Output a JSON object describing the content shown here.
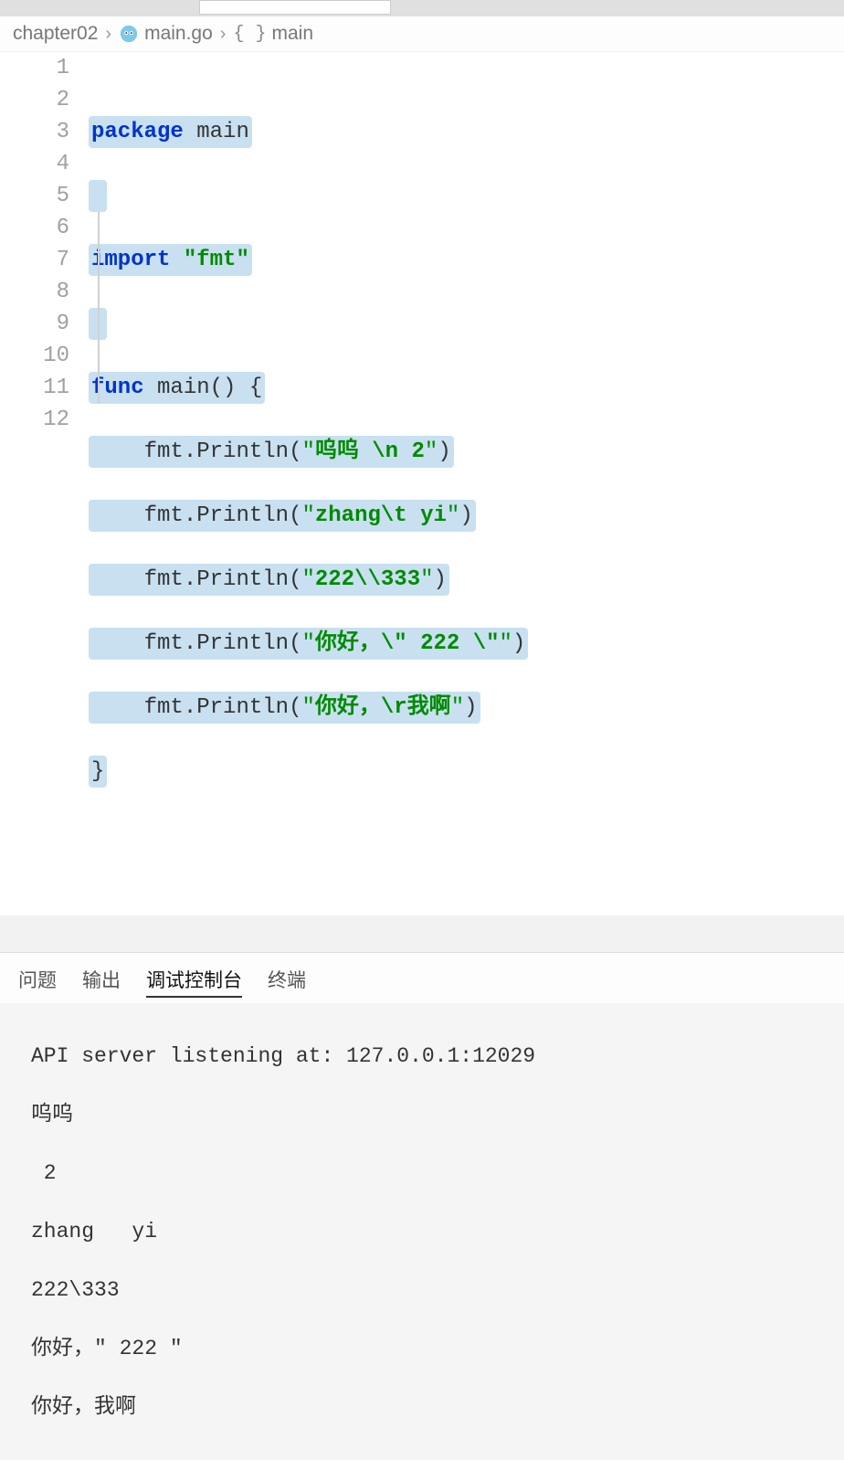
{
  "breadcrumb": {
    "folder": "chapter02",
    "file": "main.go",
    "symbol": "main"
  },
  "gutter": {
    "l1": "1",
    "l2": "2",
    "l3": "3",
    "l4": "4",
    "l5": "5",
    "l6": "6",
    "l7": "7",
    "l8": "8",
    "l9": "9",
    "l10": "10",
    "l11": "11",
    "l12": "12"
  },
  "code": {
    "l1": {
      "kw": "package",
      "ident": " main"
    },
    "l3": {
      "kw": "import",
      "space": " ",
      "str": "\"fmt\""
    },
    "l5": {
      "kw": "func",
      "ident": " main",
      "paren": "()",
      "brace": " {"
    },
    "l6": {
      "indent": "    ",
      "pkg": "fmt",
      "dot": ".",
      "fn": "Println",
      "open": "(",
      "q1": "\"",
      "s1": "呜呜 ",
      "esc": "\\n",
      "s2": " 2",
      "q2": "\"",
      "close": ")"
    },
    "l7": {
      "indent": "    ",
      "pkg": "fmt",
      "dot": ".",
      "fn": "Println",
      "open": "(",
      "q1": "\"",
      "s1": "zhang",
      "esc": "\\t",
      "s2": " yi",
      "q2": "\"",
      "close": ")"
    },
    "l8": {
      "indent": "    ",
      "pkg": "fmt",
      "dot": ".",
      "fn": "Println",
      "open": "(",
      "q1": "\"",
      "s1": "222",
      "esc": "\\\\",
      "s2": "333",
      "q2": "\"",
      "close": ")"
    },
    "l9": {
      "indent": "    ",
      "pkg": "fmt",
      "dot": ".",
      "fn": "Println",
      "open": "(",
      "q1": "\"",
      "s1": "你好，",
      "esc1": "\\\"",
      "mid": " 222 ",
      "esc2": "\\\"",
      "q2": "\"",
      "close": ")"
    },
    "l10": {
      "indent": "    ",
      "pkg": "fmt",
      "dot": ".",
      "fn": "Println",
      "open": "(",
      "q1": "\"",
      "s1": "你好，",
      "esc": "\\r",
      "s2": "我啊",
      "q2": "\"",
      "close": ")"
    },
    "l11": {
      "brace": "}"
    }
  },
  "panel": {
    "tabs": {
      "issues": "问题",
      "output": "输出",
      "debug": "调试控制台",
      "terminal": "终端"
    },
    "active_tab": "debug"
  },
  "console": {
    "l0": "API server listening at: 127.0.0.1:12029",
    "l1": "呜呜 ",
    "l2": " 2",
    "l3": "zhang   yi",
    "l4": "222\\333",
    "l5": "你好，\" 222 \"",
    "l6": "你好，我啊"
  }
}
